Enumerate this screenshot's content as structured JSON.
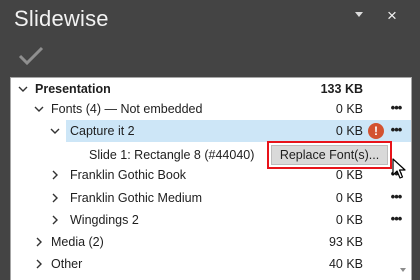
{
  "pane": {
    "title": "Slidewise",
    "options_icon": "chevron-down-icon",
    "close_icon": "×"
  },
  "toolbar": {
    "check_icon": "check-icon"
  },
  "tree": {
    "presentation": {
      "label": "Presentation",
      "size": "133 KB"
    },
    "fonts": {
      "label": "Fonts (4) — Not embedded",
      "size": "0 KB",
      "more": "•••"
    },
    "capture": {
      "label": "Capture it 2",
      "size": "0 KB",
      "warning": "!",
      "more": "•••"
    },
    "slide1": {
      "label": "Slide 1: Rectangle 8 (#44040)"
    },
    "franklin_book": {
      "label": "Franklin Gothic Book",
      "size": "0 KB",
      "more": "•••"
    },
    "franklin_medium": {
      "label": "Franklin Gothic Medium",
      "size": "0 KB",
      "more": "•••"
    },
    "wingdings": {
      "label": "Wingdings 2",
      "size": "0 KB",
      "more": "•••"
    },
    "media": {
      "label": "Media (2)",
      "size": "93 KB"
    },
    "other": {
      "label": "Other",
      "size": "40 KB"
    }
  },
  "context_menu": {
    "replace_fonts": "Replace Font(s)..."
  },
  "colors": {
    "background": "#444444",
    "selection": "#cde6f7",
    "warning": "#d35230",
    "highlight_outline": "#e8131a"
  }
}
